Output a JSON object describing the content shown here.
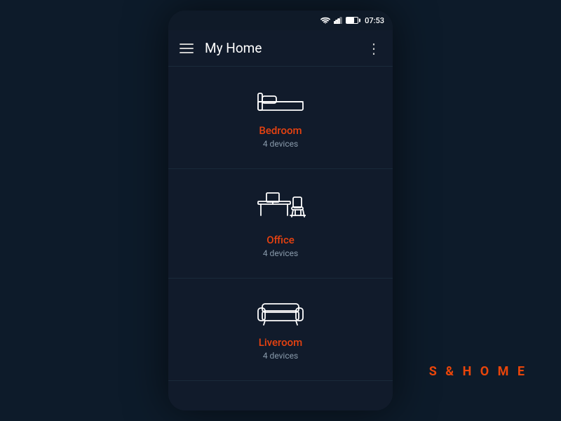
{
  "statusBar": {
    "time": "07:53"
  },
  "appBar": {
    "title": "My Home",
    "moreIconLabel": "⋮"
  },
  "brand": {
    "label": "S & H O M E"
  },
  "rooms": [
    {
      "id": "bedroom",
      "name": "Bedroom",
      "devices": "4 devices",
      "icon": "bedroom"
    },
    {
      "id": "office",
      "name": "Office",
      "devices": "4 devices",
      "icon": "office"
    },
    {
      "id": "liveroom",
      "name": "Liveroom",
      "devices": "4 devices",
      "icon": "liveroom"
    }
  ]
}
